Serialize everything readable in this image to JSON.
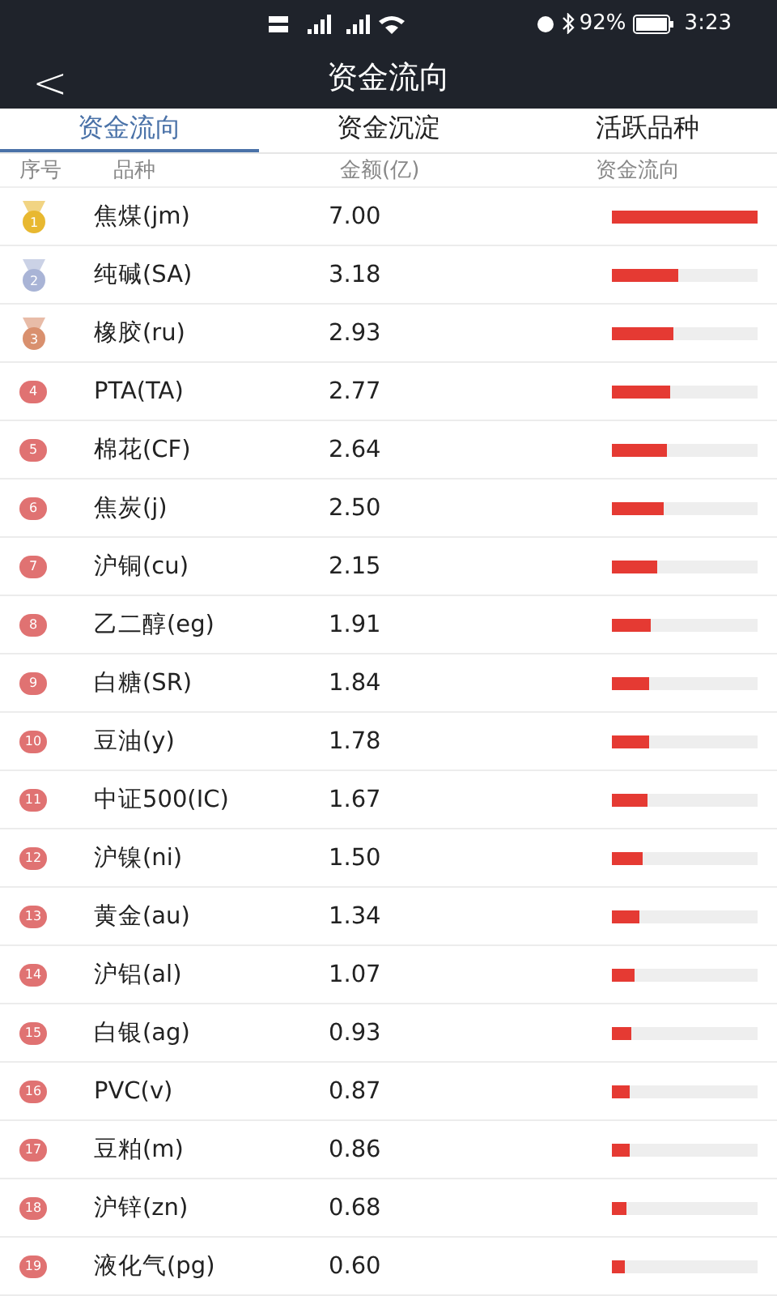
{
  "status_bar": {
    "battery": "92%",
    "time": "3:23"
  },
  "header": {
    "back": "<",
    "title": "资金流向"
  },
  "tabs": [
    {
      "label": "资金流向",
      "selected": true
    },
    {
      "label": "资金沉淀",
      "selected": false
    },
    {
      "label": "活跃品种",
      "selected": false
    }
  ],
  "table": {
    "columns": [
      "序号",
      "品种",
      "金额(亿)",
      "资金流向"
    ],
    "rows": [
      {
        "rank": "1",
        "kind": "medal",
        "color": "#e8b830",
        "name": "焦煤(jm)",
        "amount": "7.00",
        "level": 1.0
      },
      {
        "rank": "2",
        "kind": "medal",
        "color": "#a9b4d6",
        "name": "纯碱(SA)",
        "amount": "3.18",
        "level": 0.45
      },
      {
        "rank": "3",
        "kind": "medal",
        "color": "#d9906e",
        "name": "橡胶(ru)",
        "amount": "2.93",
        "level": 0.42
      },
      {
        "rank": "4",
        "kind": "circle",
        "color": "#e07272",
        "name": "PTA(TA)",
        "amount": "2.77",
        "level": 0.4
      },
      {
        "rank": "5",
        "kind": "circle",
        "color": "#e07272",
        "name": "棉花(CF)",
        "amount": "2.64",
        "level": 0.38
      },
      {
        "rank": "6",
        "kind": "circle",
        "color": "#e07272",
        "name": "焦炭(j)",
        "amount": "2.50",
        "level": 0.36
      },
      {
        "rank": "7",
        "kind": "circle",
        "color": "#e07272",
        "name": "沪铜(cu)",
        "amount": "2.15",
        "level": 0.31
      },
      {
        "rank": "8",
        "kind": "circle",
        "color": "#e07272",
        "name": "乙二醇(eg)",
        "amount": "1.91",
        "level": 0.27
      },
      {
        "rank": "9",
        "kind": "circle",
        "color": "#e07272",
        "name": "白糖(SR)",
        "amount": "1.84",
        "level": 0.26
      },
      {
        "rank": "10",
        "kind": "circle",
        "color": "#e07272",
        "name": "豆油(y)",
        "amount": "1.78",
        "level": 0.25
      },
      {
        "rank": "11",
        "kind": "circle",
        "color": "#e07272",
        "name": "中证500(IC)",
        "amount": "1.67",
        "level": 0.24
      },
      {
        "rank": "12",
        "kind": "circle",
        "color": "#e07272",
        "name": "沪镍(ni)",
        "amount": "1.50",
        "level": 0.21
      },
      {
        "rank": "13",
        "kind": "circle",
        "color": "#e07272",
        "name": "黄金(au)",
        "amount": "1.34",
        "level": 0.19
      },
      {
        "rank": "14",
        "kind": "circle",
        "color": "#e07272",
        "name": "沪铝(al)",
        "amount": "1.07",
        "level": 0.15
      },
      {
        "rank": "15",
        "kind": "circle",
        "color": "#e07272",
        "name": "白银(ag)",
        "amount": "0.93",
        "level": 0.13
      },
      {
        "rank": "16",
        "kind": "circle",
        "color": "#e07272",
        "name": "PVC(v)",
        "amount": "0.87",
        "level": 0.12
      },
      {
        "rank": "17",
        "kind": "circle",
        "color": "#e07272",
        "name": "豆粕(m)",
        "amount": "0.86",
        "level": 0.12
      },
      {
        "rank": "18",
        "kind": "circle",
        "color": "#e07272",
        "name": "沪锌(zn)",
        "amount": "0.68",
        "level": 0.1
      },
      {
        "rank": "19",
        "kind": "circle",
        "color": "#e07272",
        "name": "液化气(pg)",
        "amount": "0.60",
        "level": 0.09
      }
    ]
  }
}
